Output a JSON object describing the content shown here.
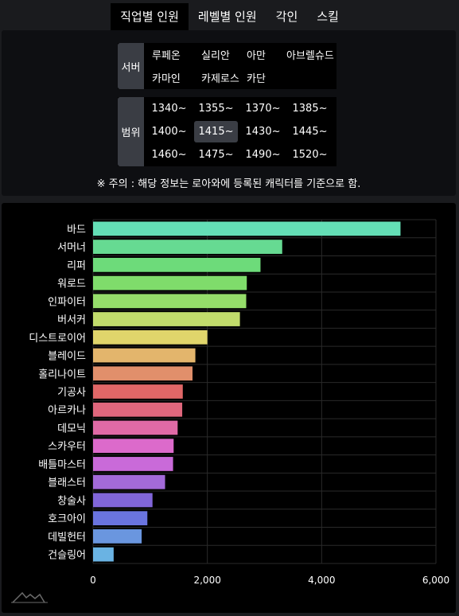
{
  "tabs": [
    {
      "label": "직업별 인원",
      "active": true
    },
    {
      "label": "레벨별 인원",
      "active": false
    },
    {
      "label": "각인",
      "active": false
    },
    {
      "label": "스킬",
      "active": false
    }
  ],
  "filters": {
    "server_label": "서버",
    "servers": [
      "루페온",
      "실리안",
      "아만",
      "아브렐슈드",
      "카마인",
      "카제로스",
      "카단"
    ],
    "range_label": "범위",
    "ranges": [
      "1340~",
      "1355~",
      "1370~",
      "1385~",
      "1400~",
      "1415~",
      "1430~",
      "1445~",
      "1460~",
      "1475~",
      "1490~",
      "1520~"
    ],
    "selected_range": "1415~",
    "notice": "※ 주의 : 해당 정보는 로아와에 등록된 캐릭터를 기준으로 함."
  },
  "colors": {
    "background": "#1a1b1e",
    "panel": "#0e0f12",
    "chart_bg": "#000000",
    "selected": "#3a3d44",
    "grid": "#2a2a2a"
  },
  "chart_data": {
    "type": "bar",
    "orientation": "horizontal",
    "categories": [
      "바드",
      "서머너",
      "리퍼",
      "워로드",
      "인파이터",
      "버서커",
      "디스트로이어",
      "블레이드",
      "홀리나이트",
      "기공사",
      "아르카나",
      "데모닉",
      "스카우터",
      "배틀마스터",
      "블래스터",
      "창술사",
      "호크아이",
      "데빌헌터",
      "건슬링어"
    ],
    "values": [
      5380,
      3310,
      2930,
      2690,
      2680,
      2570,
      2000,
      1790,
      1740,
      1570,
      1560,
      1480,
      1410,
      1400,
      1260,
      1040,
      950,
      850,
      360
    ],
    "bar_colors": [
      "#64dfb6",
      "#66da92",
      "#6ddb7a",
      "#7fdc6b",
      "#95dd6a",
      "#c2dc6c",
      "#e0d56b",
      "#e3b56c",
      "#e18f6b",
      "#e06767",
      "#e0677d",
      "#e06aa6",
      "#dc6acb",
      "#c96ad9",
      "#a36ad9",
      "#8166d9",
      "#6a74df",
      "#6a96df",
      "#6ab3e3"
    ],
    "xlim": [
      0,
      6000
    ],
    "xticks": [
      0,
      2000,
      4000,
      6000
    ],
    "xtick_labels": [
      "0",
      "2,000",
      "4,000",
      "6,000"
    ],
    "grid": true
  }
}
